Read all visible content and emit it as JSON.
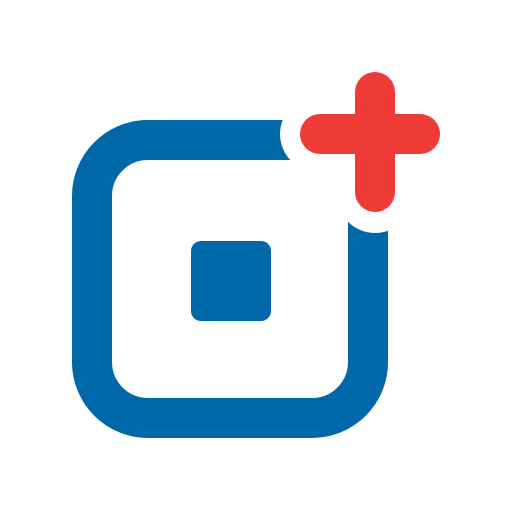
{
  "logo": {
    "name": "square-with-plus-logo",
    "icon": "add-square-icon",
    "colors": {
      "primary_blue": "#0068A8",
      "accent_red": "#EF3B36",
      "background": "#FFFFFF"
    }
  }
}
